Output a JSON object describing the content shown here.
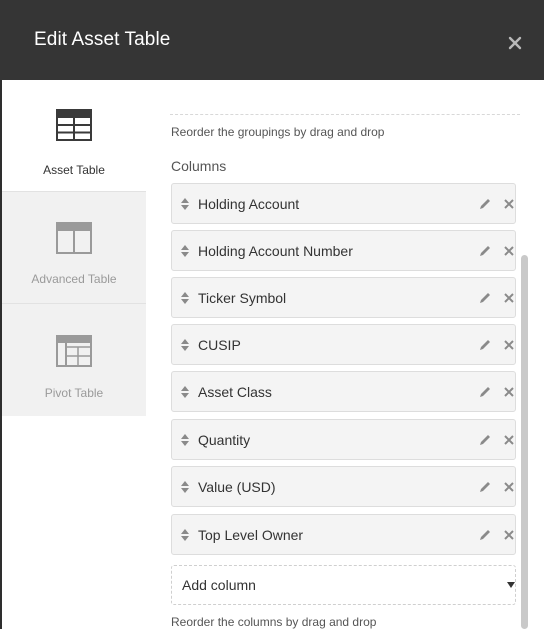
{
  "dialog": {
    "title": "Edit Asset Table",
    "close_icon": "close-icon"
  },
  "sidebar": {
    "items": [
      {
        "label": "Asset Table",
        "icon": "asset-table-icon",
        "active": true
      },
      {
        "label": "Advanced Table",
        "icon": "advanced-table-icon",
        "active": false
      },
      {
        "label": "Pivot Table",
        "icon": "pivot-table-icon",
        "active": false
      }
    ]
  },
  "content": {
    "reorder_groupings_hint": "Reorder the groupings by drag and drop",
    "columns_heading": "Columns",
    "columns": [
      {
        "name": "Holding Account"
      },
      {
        "name": "Holding Account Number"
      },
      {
        "name": "Ticker Symbol"
      },
      {
        "name": "CUSIP"
      },
      {
        "name": "Asset Class"
      },
      {
        "name": "Quantity"
      },
      {
        "name": "Value (USD)"
      },
      {
        "name": "Top Level Owner"
      }
    ],
    "add_column_label": "Add column",
    "reorder_columns_hint": "Reorder the columns by drag and drop"
  },
  "colors": {
    "header_bg": "#353535",
    "sidebar_bg": "#f1f1f1",
    "row_bg": "#f4f4f4",
    "row_border": "#dddddd",
    "icon_grey": "#9a9a9a"
  }
}
